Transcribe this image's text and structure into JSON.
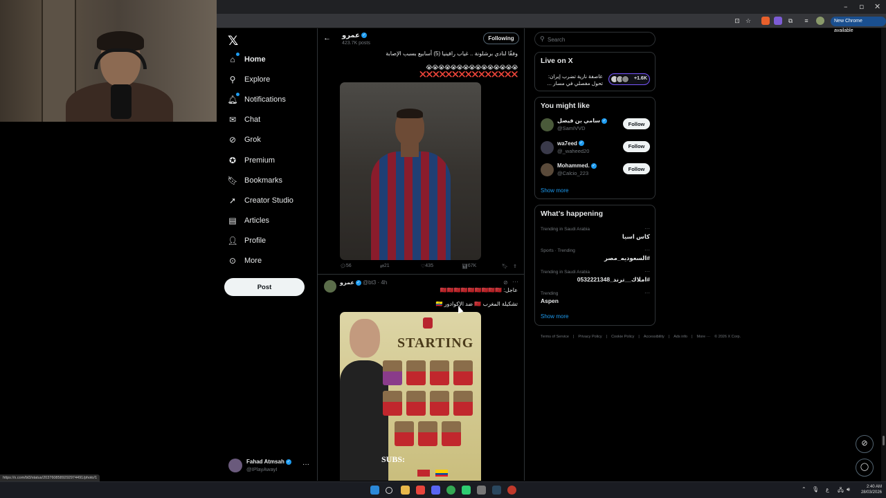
{
  "browser": {
    "new_chrome_label": "New Chrome available",
    "status_url": "https://x.com/bt3/status/2037608589292974491/photo/1"
  },
  "nav": {
    "items": [
      {
        "label": "Home",
        "icon": "home-icon",
        "badge": true
      },
      {
        "label": "Explore",
        "icon": "search-icon",
        "badge": false
      },
      {
        "label": "Notifications",
        "icon": "bell-icon",
        "badge": true
      },
      {
        "label": "Chat",
        "icon": "chat-icon",
        "badge": false
      },
      {
        "label": "Grok",
        "icon": "grok-icon",
        "badge": false
      },
      {
        "label": "Premium",
        "icon": "premium-icon",
        "badge": false
      },
      {
        "label": "Bookmarks",
        "icon": "bookmark-icon",
        "badge": false
      },
      {
        "label": "Creator Studio",
        "icon": "rocket-icon",
        "badge": false
      },
      {
        "label": "Articles",
        "icon": "article-icon",
        "badge": false
      },
      {
        "label": "Profile",
        "icon": "person-icon",
        "badge": false
      },
      {
        "label": "More",
        "icon": "more-circle-icon",
        "badge": false
      }
    ],
    "post_label": "Post"
  },
  "account": {
    "name": "Fahad Atmsah",
    "handle": "@IPlayAwayI"
  },
  "profile_header": {
    "name": "عمرو",
    "posts": "423.7K posts",
    "following_label": "Following"
  },
  "tweet1": {
    "text": "وفقًا لنادي برشلونة .. غياب رافينيا (5) أسابيع بسبب الإصابة",
    "emoji_line": "😭😭😭😭😭😭😭😭😭😭😭😭😭😭😭",
    "cross_line": "❌❌❌❌❌❌❌❌❌❌❌❌❌❌❌",
    "stats": {
      "replies": "56",
      "reposts": "21",
      "likes": "435",
      "views": "67K"
    }
  },
  "tweet2": {
    "name": "عمرو",
    "handle": "@bt3",
    "time": "4h",
    "line1": "عاجل: 🇲🇦🇲🇦🇲🇦🇲🇦🇲🇦🇲🇦🇲🇦🇲🇦🇲🇦",
    "line2": "تشكيلة المغرب 🇲🇦 ضد الإكوادور 🇪🇨",
    "media_title": "STARTING",
    "media_subs": "SUBS:"
  },
  "search": {
    "placeholder": "Search"
  },
  "live": {
    "title": "Live on X",
    "text": "عاصفة نارية تضرب إيران: تحول مفصلي في مسار ...",
    "count": "+1.6K"
  },
  "who_to_follow": {
    "title": "You might like",
    "users": [
      {
        "name": "سامي بن فيصل",
        "handle": "@SamIVVD",
        "button": "Follow"
      },
      {
        "name": "wa7eed",
        "handle": "@_waheed20",
        "button": "Follow"
      },
      {
        "name": "Mohammed.",
        "handle": "@Calcio_223",
        "button": "Follow"
      }
    ],
    "show_more": "Show more"
  },
  "trends": {
    "title": "What’s happening",
    "items": [
      {
        "category": "Trending in Saudi Arabia",
        "name": "كاس اسيا",
        "ltr": false
      },
      {
        "category": "Sports · Trending",
        "name": "#السعوديه_مصر",
        "ltr": false
      },
      {
        "category": "Trending in Saudi Arabia",
        "name": "#املاك__ترند_0532221348",
        "ltr": false
      },
      {
        "category": "Trending",
        "name": "Aspen",
        "ltr": true
      }
    ],
    "show_more": "Show more"
  },
  "footer": {
    "links": [
      "Terms of Service",
      "|",
      "Privacy Policy",
      "|",
      "Cookie Policy",
      "|",
      "Accessibility",
      "|",
      "Ads info",
      "|",
      "More ···",
      "© 2026 X Corp."
    ]
  },
  "clock": {
    "time": "2:40 AM",
    "date": "28/03/2026"
  },
  "colors": {
    "accent": "#1d9bf0",
    "background": "#000000",
    "border": "#2f3336",
    "muted": "#71767b"
  }
}
